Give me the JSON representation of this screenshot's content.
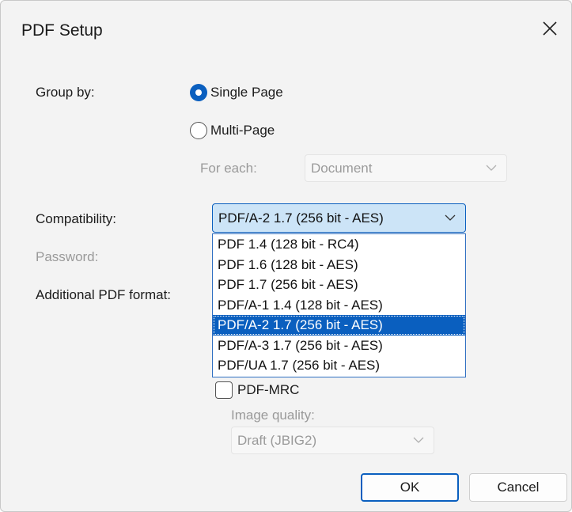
{
  "dialog": {
    "title": "PDF Setup"
  },
  "group_by": {
    "label": "Group by:",
    "options": [
      {
        "label": "Single Page",
        "checked": true
      },
      {
        "label": "Multi-Page",
        "checked": false
      }
    ],
    "for_each_label": "For each:",
    "for_each_value": "Document"
  },
  "compatibility": {
    "label": "Compatibility:",
    "selected": "PDF/A-2 1.7 (256 bit - AES)",
    "options": [
      "PDF 1.4 (128 bit - RC4)",
      "PDF 1.6 (128 bit - AES)",
      "PDF 1.7 (256 bit - AES)",
      "PDF/A-1 1.4 (128 bit - AES)",
      "PDF/A-2 1.7 (256 bit - AES)",
      "PDF/A-3 1.7 (256 bit - AES)",
      "PDF/UA 1.7 (256 bit - AES)"
    ],
    "selected_index": 4
  },
  "password": {
    "label": "Password:"
  },
  "additional": {
    "label": "Additional PDF format:",
    "mrc_label": "PDF-MRC",
    "mrc_checked": false,
    "image_quality_label": "Image quality:",
    "image_quality_value": "Draft (JBIG2)"
  },
  "buttons": {
    "ok": "OK",
    "cancel": "Cancel"
  },
  "colors": {
    "accent": "#0a5fbf",
    "dialog_bg": "#f3f3f3",
    "disabled_text": "#9a9a9a"
  }
}
